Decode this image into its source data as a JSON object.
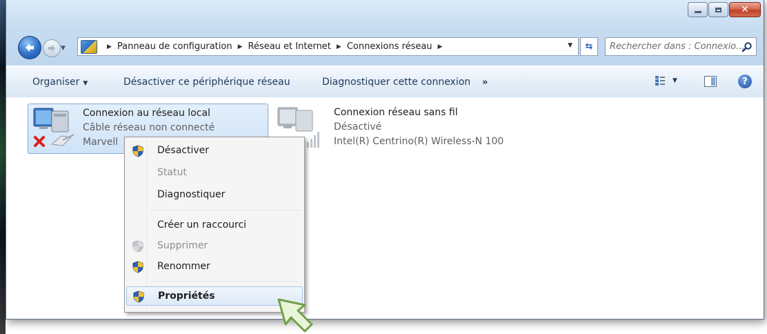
{
  "window": {
    "controls": {
      "minimize": "minimize",
      "maximize": "maximize",
      "close": "close"
    }
  },
  "address_bar": {
    "breadcrumbs": [
      "Panneau de configuration",
      "Réseau et Internet",
      "Connexions réseau"
    ],
    "search_placeholder": "Rechercher dans : Connexio..."
  },
  "toolbar": {
    "organize": "Organiser",
    "disable_device": "Désactiver ce périphérique réseau",
    "diagnose": "Diagnostiquer cette connexion",
    "more": "»"
  },
  "connections": [
    {
      "name": "Connexion au réseau local",
      "status": "Câble réseau non connecté",
      "device": "Marvell",
      "selected": true
    },
    {
      "name": "Connexion réseau sans fil",
      "status": "Désactivé",
      "device": "Intel(R) Centrino(R) Wireless-N 100",
      "selected": false
    }
  ],
  "context_menu": {
    "items": [
      {
        "label": "Désactiver",
        "shield": true,
        "enabled": true
      },
      {
        "label": "Statut",
        "shield": false,
        "enabled": false
      },
      {
        "label": "Diagnostiquer",
        "shield": false,
        "enabled": true
      },
      {
        "label": "Créer un raccourci",
        "shield": false,
        "enabled": true
      },
      {
        "label": "Supprimer",
        "shield": true,
        "enabled": false
      },
      {
        "label": "Renommer",
        "shield": true,
        "enabled": true
      },
      {
        "label": "Propriétés",
        "shield": true,
        "enabled": true,
        "bold": true,
        "highlighted": true
      }
    ]
  },
  "colors": {
    "titlebar": "#c7dcf1",
    "selection": "#cfe3f8",
    "menu_highlight": "#dde9f8",
    "disabled_text": "#8d8d8d",
    "close_button": "#c24128"
  },
  "icons": [
    "back-arrow-icon",
    "forward-arrow-icon",
    "control-panel-icon",
    "refresh-icon",
    "search-icon",
    "views-icon",
    "preview-pane-icon",
    "help-icon",
    "wired-connection-icon",
    "wireless-connection-icon",
    "uac-shield-icon",
    "cursor-arrow-icon"
  ]
}
